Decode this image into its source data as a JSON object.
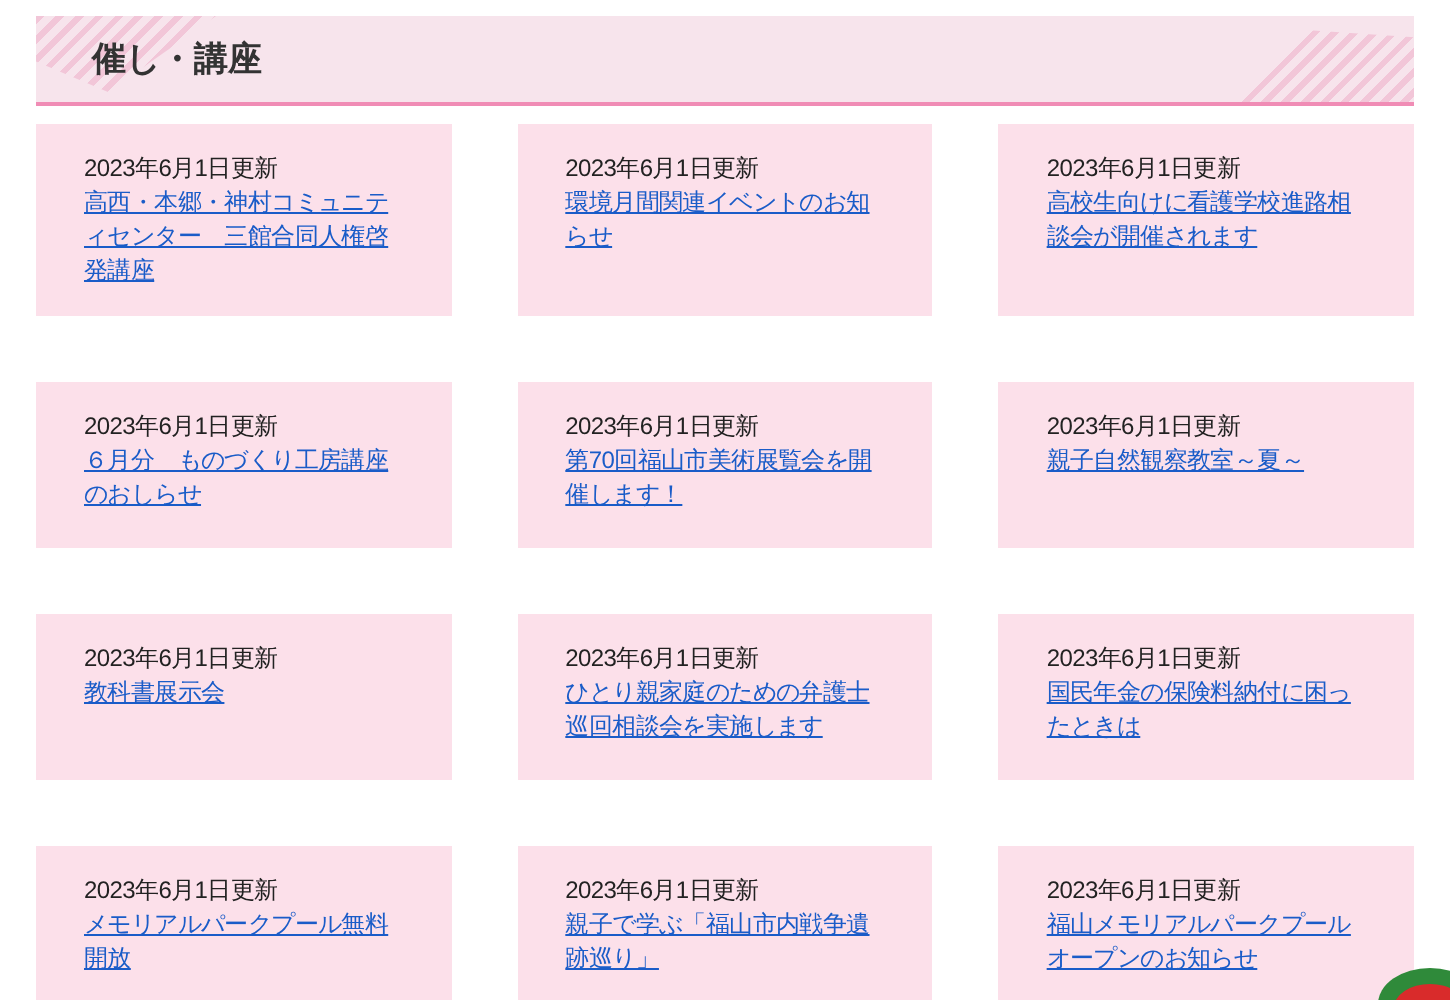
{
  "section": {
    "title": "催し・講座"
  },
  "items": [
    {
      "date": "2023年6月1日更新",
      "title": "高西・本郷・神村コミュニティセンター　三館合同人権啓発講座"
    },
    {
      "date": "2023年6月1日更新",
      "title": "環境月間関連イベントのお知らせ"
    },
    {
      "date": "2023年6月1日更新",
      "title": "高校生向けに看護学校進路相談会が開催されます"
    },
    {
      "date": "2023年6月1日更新",
      "title": "６月分　ものづくり工房講座のおしらせ"
    },
    {
      "date": "2023年6月1日更新",
      "title": "第70回福山市美術展覧会を開催します！"
    },
    {
      "date": "2023年6月1日更新",
      "title": "親子自然観察教室～夏～"
    },
    {
      "date": "2023年6月1日更新",
      "title": "教科書展示会"
    },
    {
      "date": "2023年6月1日更新",
      "title": "ひとり親家庭のための弁護士巡回相談会を実施します"
    },
    {
      "date": "2023年6月1日更新",
      "title": "国民年金の保険料納付に困ったときは"
    },
    {
      "date": "2023年6月1日更新",
      "title": "メモリアルパークプール無料開放"
    },
    {
      "date": "2023年6月1日更新",
      "title": "親子で学ぶ「福山市内戦争遺跡巡り」"
    },
    {
      "date": "2023年6月1日更新",
      "title": "福山メモリアルパークプールオープンのお知らせ"
    }
  ]
}
